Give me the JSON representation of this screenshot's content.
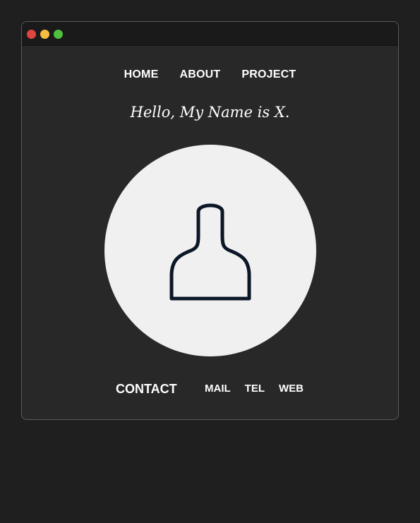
{
  "window": {
    "controls": [
      {
        "name": "close",
        "color": "#e0443e"
      },
      {
        "name": "minimize",
        "color": "#f6be40"
      },
      {
        "name": "zoom",
        "color": "#4fc13c"
      }
    ]
  },
  "nav": {
    "items": [
      {
        "label": "HOME"
      },
      {
        "label": "ABOUT"
      },
      {
        "label": "PROJECT"
      }
    ]
  },
  "hero": {
    "greeting": "Hello, My Name is X.",
    "avatar_icon": "user-silhouette-icon",
    "avatar_bg": "#f0f0f0",
    "avatar_stroke": "#0b1626"
  },
  "contact": {
    "heading": "CONTACT",
    "links": [
      {
        "label": "MAIL"
      },
      {
        "label": "TEL"
      },
      {
        "label": "WEB"
      }
    ]
  }
}
